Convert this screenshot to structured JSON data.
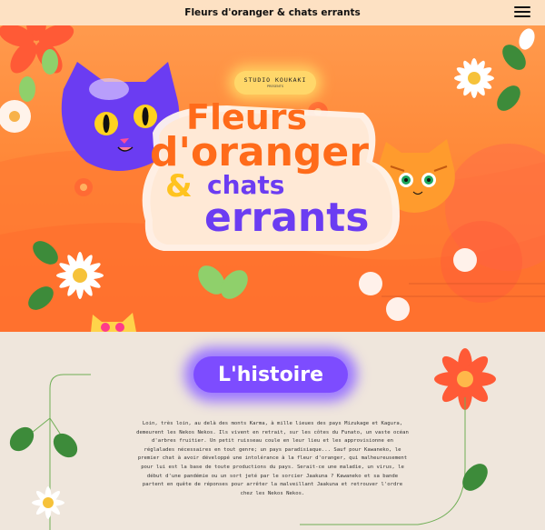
{
  "header": {
    "title": "Fleurs d'oranger & chats errants",
    "menu_icon": "hamburger-menu-icon"
  },
  "hero": {
    "studio_name": "STUDIO KOUKAKI",
    "studio_tagline": "PRESENTS",
    "logo_line1": "Fleurs",
    "logo_line2": "d'oranger",
    "logo_amp": "&",
    "logo_line3": "chats",
    "logo_line4": "errants"
  },
  "story": {
    "title": "L'histoire",
    "paragraph": "Loin, très loin, au delà des monts Karma, à mille lieues des pays Mizukage et Kagura, demeurent les Nekos Nekos. Ils vivent en retrait, sur les côtes du Funato, un vaste océan d'arbres fruitier. Un petit ruisseau coule en leur lieu et les approvisionne en réglalades nécessaires en tout genre; un pays paradisiaque... Sauf pour Kawaneko, le premier chat à avoir développé une intolérance à la fleur d'oranger, qui malheureusement pour lui est la base de toute productions du pays. Serait-ce une maladie, un virus, le début d'une pandémie ou un sort jeté par le sorcier Jaakuna ? Kawaneko et sa bande partent en quête de réponses pour arrêter la malveillant Jaakuna et retrouver l'ordre chez les Nekos Nekos."
  },
  "colors": {
    "header_bg": "#fde1c3",
    "hero_orange": "#ff8a3a",
    "accent_purple": "#7d4cff",
    "story_bg": "#efe6dc"
  }
}
